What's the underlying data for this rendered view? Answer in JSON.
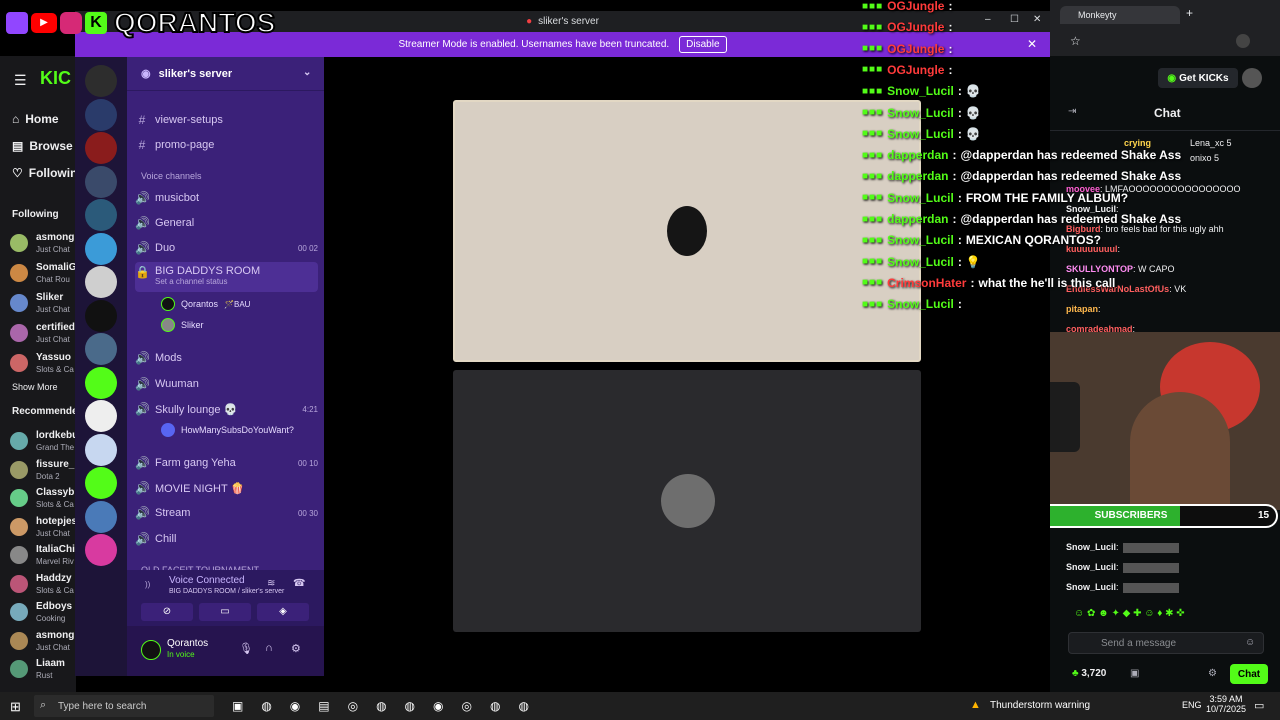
{
  "streamer_logo": {
    "name": "QORANTOS"
  },
  "kick_left": {
    "nav": [
      {
        "label": "Home"
      },
      {
        "label": "Browse"
      },
      {
        "label": "Following"
      }
    ],
    "following_header": "Following",
    "following": [
      {
        "name": "asmong",
        "sub": "Just Chat"
      },
      {
        "name": "SomaliG",
        "sub": "Chat Rou"
      },
      {
        "name": "Sliker",
        "sub": "Just Chat"
      },
      {
        "name": "certified",
        "sub": "Just Chat"
      },
      {
        "name": "Yassuo",
        "sub": "Slots & Ca"
      }
    ],
    "show_more": "Show More",
    "recommended_header": "Recommende",
    "recommended": [
      {
        "name": "lordkebu",
        "sub": "Grand The"
      },
      {
        "name": "fissure_",
        "sub": "Dota 2"
      },
      {
        "name": "Classyb",
        "sub": "Slots & Ca"
      },
      {
        "name": "hotepjes",
        "sub": "Just Chat"
      },
      {
        "name": "ItaliaChi",
        "sub": "Marvel Riv"
      },
      {
        "name": "Haddzy",
        "sub": "Slots & Ca"
      },
      {
        "name": "Edboys",
        "sub": "Cooking"
      },
      {
        "name": "asmong",
        "sub": "Just Chat"
      },
      {
        "name": "Liaam",
        "sub": "Rust"
      }
    ]
  },
  "discord": {
    "window_title": "sliker's server",
    "banner_text": "Streamer Mode is enabled. Usernames have been truncated.",
    "banner_button": "Disable",
    "server_name": "sliker's server",
    "channels_top": [
      {
        "name": "viewer-setups",
        "icon": "hash"
      },
      {
        "name": "promo-page",
        "icon": "hash"
      }
    ],
    "voice_header": "Voice channels",
    "voice_channels": [
      {
        "name": "musicbot",
        "meta": ""
      },
      {
        "name": "General",
        "meta": ""
      },
      {
        "name": "Duo",
        "meta": "00 02"
      },
      {
        "name": "BIG DADDYS ROOM",
        "meta": "",
        "status": "Set a channel status"
      },
      {
        "name": "Mods",
        "meta": ""
      },
      {
        "name": "Wuuman",
        "meta": ""
      },
      {
        "name": "Skully lounge 💀",
        "meta": "4:21"
      },
      {
        "name": "Farm gang Yeha",
        "meta": "00 10"
      },
      {
        "name": "MOVIE NIGHT 🍿",
        "meta": ""
      },
      {
        "name": "Stream",
        "meta": "00 30"
      },
      {
        "name": "Chill",
        "meta": ""
      }
    ],
    "big_daddys_members": [
      {
        "name": "Qorantos",
        "tag": "🪄BAU"
      },
      {
        "name": "Sliker",
        "tag": ""
      }
    ],
    "skully_member": "HowManySubsDoYouWant?",
    "bottom_channel": "OLD FACEIT TOURNAMENT",
    "voice_connected": {
      "title": "Voice Connected",
      "location": "BIG DADDYS ROOM / sliker's server"
    },
    "user": {
      "name": "Qorantos",
      "status": "In voice"
    }
  },
  "overlay_chat": [
    {
      "user": "OGJungle",
      "color": "#ff3b3b",
      "text": ""
    },
    {
      "user": "OGJungle",
      "color": "#ff3b3b",
      "text": ""
    },
    {
      "user": "OGJungle",
      "color": "#ff3b3b",
      "text": ""
    },
    {
      "user": "OGJungle",
      "color": "#ff3b3b",
      "text": ""
    },
    {
      "user": "Snow_Lucil",
      "color": "#53fc18",
      "text": "💀"
    },
    {
      "user": "Snow_Lucil",
      "color": "#53fc18",
      "text": "💀"
    },
    {
      "user": "Snow_Lucil",
      "color": "#53fc18",
      "text": "💀"
    },
    {
      "user": "dapperdan",
      "color": "#53fc18",
      "text": "@dapperdan has redeemed Shake Ass"
    },
    {
      "user": "dapperdan",
      "color": "#53fc18",
      "text": "@dapperdan has redeemed Shake Ass"
    },
    {
      "user": "Snow_Lucil",
      "color": "#53fc18",
      "text": "FROM THE FAMILY ALBUM?"
    },
    {
      "user": "dapperdan",
      "color": "#53fc18",
      "text": "@dapperdan has redeemed Shake Ass"
    },
    {
      "user": "Snow_Lucil",
      "color": "#53fc18",
      "text": "MEXICAN QORANTOS?"
    },
    {
      "user": "Snow_Lucil",
      "color": "#53fc18",
      "text": "💡"
    },
    {
      "user": "CrimsonHater",
      "color": "#ff3b3b",
      "text": "what the he'll is this call"
    },
    {
      "user": "Snow_Lucil",
      "color": "#53fc18",
      "text": ""
    }
  ],
  "kick_right": {
    "get_kicks": "Get KICKs",
    "chat_title": "Chat",
    "top_chatters": [
      {
        "name": "crying",
        "n": ""
      },
      {
        "name": "Lena_xc",
        "n": "5"
      },
      {
        "name": "onixo",
        "n": "5"
      }
    ],
    "messages": [
      {
        "user": "moovee",
        "text": "LMFAOOOOOOOOOOOOOOOO",
        "color": "#ff5fd2"
      },
      {
        "user": "Snow_Lucil",
        "text": "",
        "color": "#efeff1"
      },
      {
        "user": "Bigburd",
        "text": "bro feels bad for this ugly ahh",
        "color": "#ff5f5f"
      },
      {
        "user": "kuuuuuuuul",
        "text": "",
        "color": "#ff5f5f"
      },
      {
        "user": "SKULLYONTOP",
        "text": "W CAPO",
        "color": "#ff8cf2"
      },
      {
        "user": "EndlessWarNoLastOfUs",
        "text": "VK",
        "color": "#ff5f5f"
      },
      {
        "user": "pitapan",
        "text": "",
        "color": "#ffb84d"
      },
      {
        "user": "comradeahmad",
        "text": "",
        "color": "#ff5f5f"
      }
    ],
    "sub_bar": {
      "current": "10",
      "label": "SUBSCRIBERS",
      "goal": "15",
      "progress": 0.67
    },
    "bottom_messages": [
      {
        "user": "Snow_Lucil"
      },
      {
        "user": "Snow_Lucil"
      },
      {
        "user": "Snow_Lucil"
      }
    ],
    "input_placeholder": "Send a message",
    "kicks_count": "3,720",
    "chat_button": "Chat"
  },
  "browser": {
    "tab_title": "Monkeyty"
  },
  "taskbar": {
    "search_placeholder": "Type here to search",
    "weather": "Thunderstorm warning",
    "lang": "ENG",
    "time": "3:59 AM",
    "date": "10/7/2025"
  }
}
